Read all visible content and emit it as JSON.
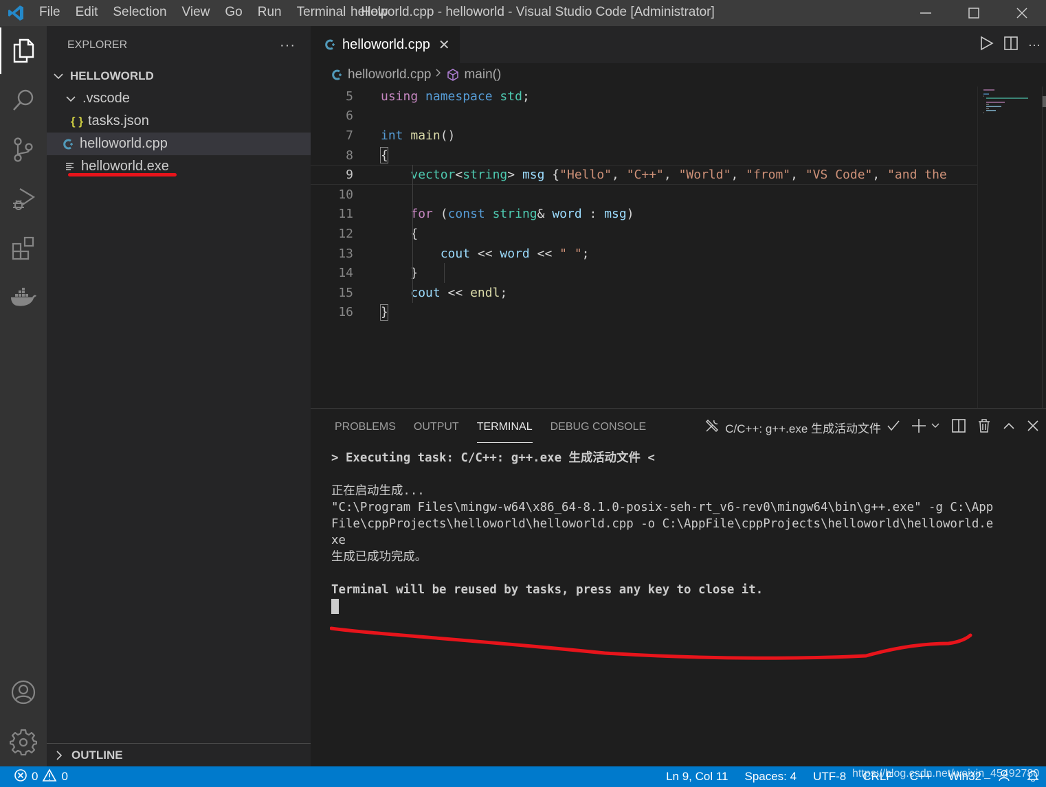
{
  "titlebar": {
    "menu": [
      "File",
      "Edit",
      "Selection",
      "View",
      "Go",
      "Run",
      "Terminal",
      "Help"
    ],
    "window_title": "helloworld.cpp - helloworld - Visual Studio Code [Administrator]"
  },
  "activity_bar": {
    "items": [
      "explorer",
      "search",
      "source-control",
      "run-and-debug",
      "extensions",
      "docker"
    ],
    "bottom": [
      "accounts",
      "manage"
    ]
  },
  "sidebar": {
    "title": "EXPLORER",
    "more": "···",
    "root": "HELLOWORLD",
    "tree": [
      {
        "label": ".vscode",
        "type": "folder",
        "expanded": true
      },
      {
        "label": "tasks.json",
        "type": "json",
        "icon": "{ }"
      },
      {
        "label": "helloworld.cpp",
        "type": "cpp",
        "selected": true
      },
      {
        "label": "helloworld.exe",
        "type": "exe",
        "annotated": true
      }
    ],
    "outline": "OUTLINE"
  },
  "editor": {
    "tab": {
      "label": "helloworld.cpp",
      "close": "✕"
    },
    "breadcrumb": {
      "file": "helloworld.cpp",
      "symbol": "main()"
    },
    "current_line": 9,
    "lines": [
      {
        "n": "5",
        "tokens": [
          [
            "ctrl",
            "using"
          ],
          [
            "p",
            " "
          ],
          [
            "kw",
            "namespace"
          ],
          [
            "p",
            " "
          ],
          [
            "type",
            "std"
          ],
          [
            "p",
            ";"
          ]
        ]
      },
      {
        "n": "6",
        "tokens": []
      },
      {
        "n": "7",
        "tokens": [
          [
            "kw",
            "int"
          ],
          [
            "p",
            " "
          ],
          [
            "fn",
            "main"
          ],
          [
            "p",
            "()"
          ]
        ]
      },
      {
        "n": "8",
        "tokens": [
          [
            "p",
            "{"
          ]
        ]
      },
      {
        "n": "9",
        "tokens": [
          [
            "p",
            "    "
          ],
          [
            "type",
            "vector"
          ],
          [
            "p",
            "<"
          ],
          [
            "type",
            "string"
          ],
          [
            "p",
            "> "
          ],
          [
            "var",
            "msg"
          ],
          [
            "p",
            " {"
          ],
          [
            "str",
            "\"Hello\""
          ],
          [
            "p",
            ", "
          ],
          [
            "str",
            "\"C++\""
          ],
          [
            "p",
            ", "
          ],
          [
            "str",
            "\"World\""
          ],
          [
            "p",
            ", "
          ],
          [
            "str",
            "\"from\""
          ],
          [
            "p",
            ", "
          ],
          [
            "str",
            "\"VS Code\""
          ],
          [
            "p",
            ", "
          ],
          [
            "str",
            "\"and the"
          ]
        ]
      },
      {
        "n": "10",
        "tokens": []
      },
      {
        "n": "11",
        "tokens": [
          [
            "p",
            "    "
          ],
          [
            "ctrl",
            "for"
          ],
          [
            "p",
            " ("
          ],
          [
            "kw",
            "const"
          ],
          [
            "p",
            " "
          ],
          [
            "type",
            "string"
          ],
          [
            "p",
            "& "
          ],
          [
            "var",
            "word"
          ],
          [
            "p",
            " : "
          ],
          [
            "var",
            "msg"
          ],
          [
            "p",
            ")"
          ]
        ]
      },
      {
        "n": "12",
        "tokens": [
          [
            "p",
            "    {"
          ]
        ]
      },
      {
        "n": "13",
        "tokens": [
          [
            "p",
            "        "
          ],
          [
            "var",
            "cout"
          ],
          [
            "p",
            " << "
          ],
          [
            "var",
            "word"
          ],
          [
            "p",
            " << "
          ],
          [
            "str",
            "\" \""
          ],
          [
            "p",
            ";"
          ]
        ]
      },
      {
        "n": "14",
        "tokens": [
          [
            "p",
            "    }"
          ]
        ]
      },
      {
        "n": "15",
        "tokens": [
          [
            "p",
            "    "
          ],
          [
            "var",
            "cout"
          ],
          [
            "p",
            " << "
          ],
          [
            "fn",
            "endl"
          ],
          [
            "p",
            ";"
          ]
        ]
      },
      {
        "n": "16",
        "tokens": [
          [
            "p",
            "}"
          ]
        ]
      }
    ]
  },
  "panel": {
    "tabs": [
      "PROBLEMS",
      "OUTPUT",
      "TERMINAL",
      "DEBUG CONSOLE"
    ],
    "active_tab": "TERMINAL",
    "terminal_selector": "C/C++: g++.exe 生成活动文件",
    "terminal_lines": [
      {
        "text": "> Executing task: C/C++: g++.exe 生成活动文件 <",
        "bold": true
      },
      {
        "text": "",
        "bold": false
      },
      {
        "text": "正在启动生成...",
        "bold": false
      },
      {
        "text": "\"C:\\Program Files\\mingw-w64\\x86_64-8.1.0-posix-seh-rt_v6-rev0\\mingw64\\bin\\g++.exe\" -g C:\\App",
        "bold": false
      },
      {
        "text": "File\\cppProjects\\helloworld\\helloworld.cpp -o C:\\AppFile\\cppProjects\\helloworld\\helloworld.e",
        "bold": false
      },
      {
        "text": "xe",
        "bold": false
      },
      {
        "text": "生成已成功完成。",
        "bold": false
      },
      {
        "text": "",
        "bold": false
      },
      {
        "text": "Terminal will be reused by tasks, press any key to close it.",
        "bold": true
      }
    ]
  },
  "statusbar": {
    "errors": "0",
    "warnings": "0",
    "position": "Ln 9, Col 11",
    "spaces": "Spaces: 4",
    "encoding": "UTF-8",
    "eol": "CRLF",
    "language": "C++",
    "platform": "Win32",
    "watermark": "https://blog.csdn.net/weixin_45492780"
  },
  "colors": {
    "accent": "#007acc",
    "annotation_red": "#e8141b"
  }
}
